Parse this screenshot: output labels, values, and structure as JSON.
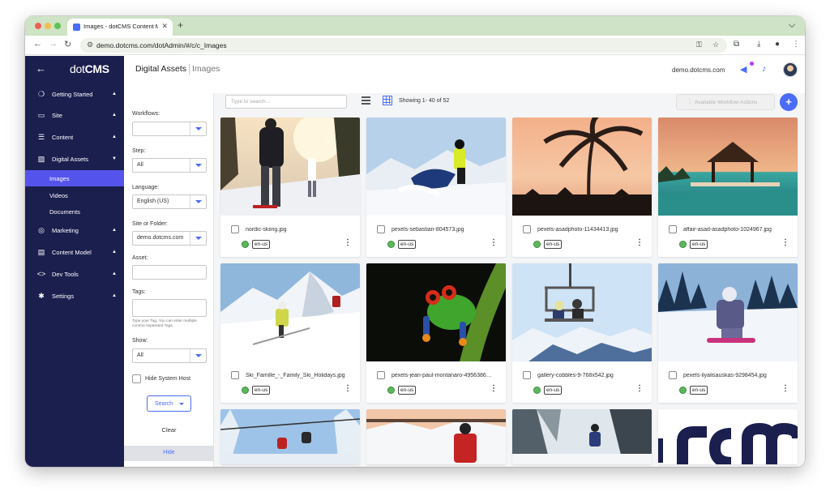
{
  "browser": {
    "tab_title": "Images - dotCMS Content Ma",
    "url": "demo.dotcms.com/dotAdmin/#/c/c_Images"
  },
  "sidebar": {
    "logo_light": "dot",
    "logo_bold": "CMS",
    "items": [
      {
        "label": "Getting Started",
        "icon": "rocket-icon"
      },
      {
        "label": "Site",
        "icon": "folder-icon"
      },
      {
        "label": "Content",
        "icon": "list-icon"
      },
      {
        "label": "Digital Assets",
        "icon": "image-icon"
      },
      {
        "label": "Marketing",
        "icon": "target-icon"
      },
      {
        "label": "Content Model",
        "icon": "document-icon"
      },
      {
        "label": "Dev Tools",
        "icon": "code-icon"
      },
      {
        "label": "Settings",
        "icon": "gear-icon"
      }
    ],
    "subitems": [
      {
        "label": "Images"
      },
      {
        "label": "Videos"
      },
      {
        "label": "Documents"
      }
    ]
  },
  "header": {
    "title": "Digital Assets",
    "subtitle": "Images",
    "host": "demo.dotcms.com"
  },
  "filters": {
    "workflows_label": "Workflows:",
    "workflows_value": "",
    "step_label": "Step:",
    "step_value": "All",
    "language_label": "Language:",
    "language_value": "English (US)",
    "site_label": "Site or Folder:",
    "site_value": "demo.dotcms.com",
    "asset_label": "Asset:",
    "tags_label": "Tags:",
    "tags_hint": "Type your Tag. You can enter multiple comma separated Tags.",
    "show_label": "Show:",
    "show_value": "All",
    "hide_system_host": "Hide System Host",
    "search_button": "Search",
    "clear_button": "Clear",
    "hide_button": "Hide"
  },
  "toolbar": {
    "search_placeholder": "Type to search...",
    "showing": "Showing 1- 40 of 52",
    "workflow_actions": "Available Workflow Actions"
  },
  "assets": [
    {
      "title": "nordic-skiing.jpg",
      "lang": "en-us"
    },
    {
      "title": "pexels-sebastian-804573.jpg",
      "lang": "en-us"
    },
    {
      "title": "pexels-asadphoto-11434413.jpg",
      "lang": "en-us"
    },
    {
      "title": "affair-asad-asadphoto-1024967.jpg",
      "lang": "en-us"
    },
    {
      "title": "Ski_Famille_-_Family_Ski_Holidays.jpg",
      "lang": "en-us"
    },
    {
      "title": "pexels-jean-paul-montanaro-49563862-...",
      "lang": "en-us"
    },
    {
      "title": "gallery-cobbles-9-768x542.jpg",
      "lang": "en-us"
    },
    {
      "title": "pexels-ilyalisauskas-9298454.jpg",
      "lang": "en-us"
    },
    {
      "title": "",
      "lang": ""
    },
    {
      "title": "",
      "lang": ""
    },
    {
      "title": "",
      "lang": ""
    },
    {
      "title": "",
      "lang": ""
    }
  ]
}
